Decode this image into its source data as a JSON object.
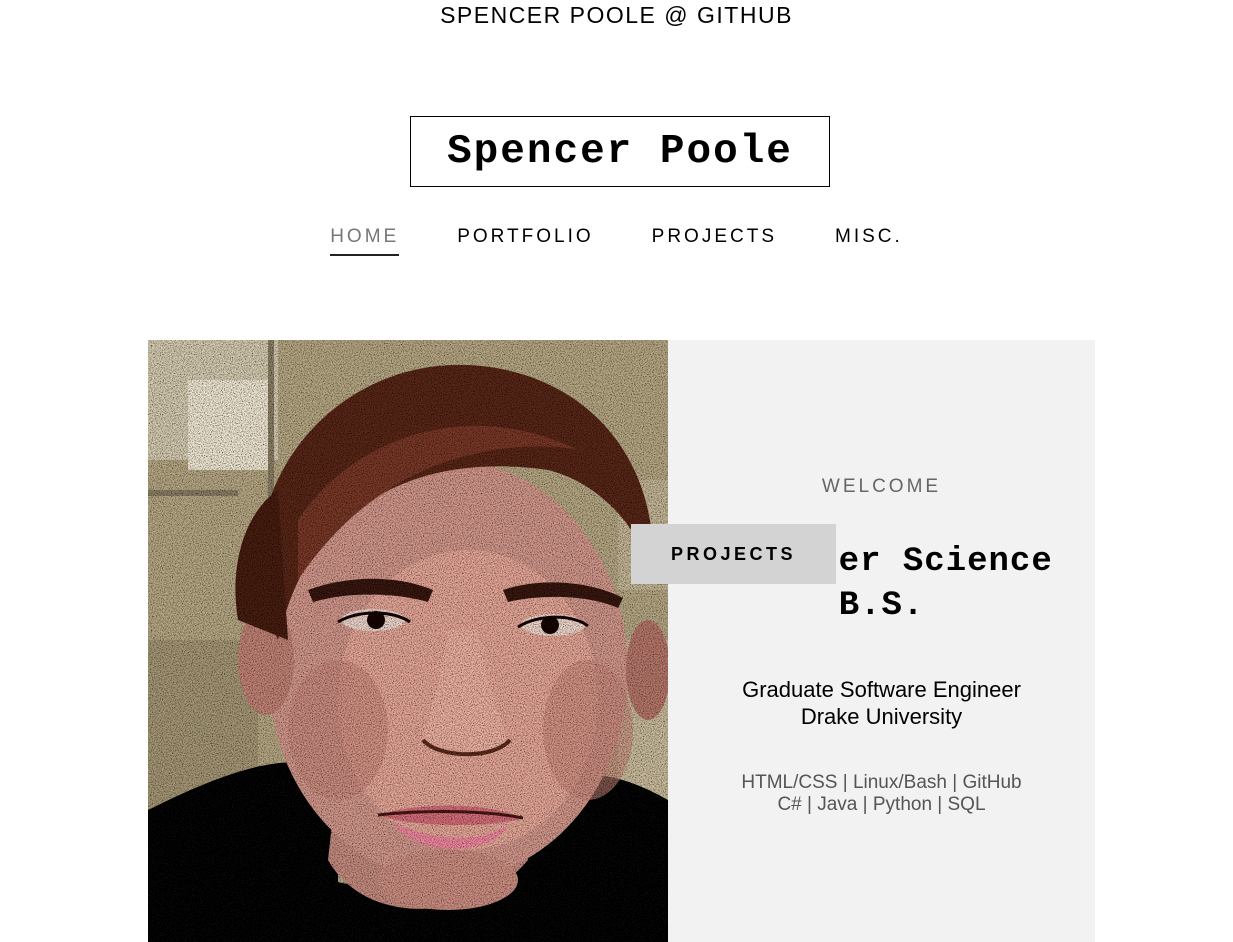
{
  "header": {
    "site_link": "SPENCER POOLE @ GITHUB"
  },
  "logo": {
    "title": "Spencer Poole"
  },
  "nav": {
    "items": [
      {
        "label": "HOME",
        "active": true
      },
      {
        "label": "PORTFOLIO",
        "active": false
      },
      {
        "label": "PROJECTS",
        "active": false
      },
      {
        "label": "MISC.",
        "active": false
      }
    ]
  },
  "hero": {
    "photo_subject": "stylized portrait photo",
    "welcome": "WELCOME",
    "headline_line1": "Computer Science",
    "headline_line2": "B.S.",
    "role_line1": "Graduate Software Engineer",
    "role_line2": "Drake University",
    "skills_line1": "HTML/CSS | Linux/Bash | GitHub",
    "skills_line2": "C# | Java | Python | SQL",
    "button_label": "PROJECTS"
  },
  "colors": {
    "info_panel_bg": "#f2f2f2",
    "button_bg": "#d3d3d3",
    "nav_active": "#777777"
  }
}
